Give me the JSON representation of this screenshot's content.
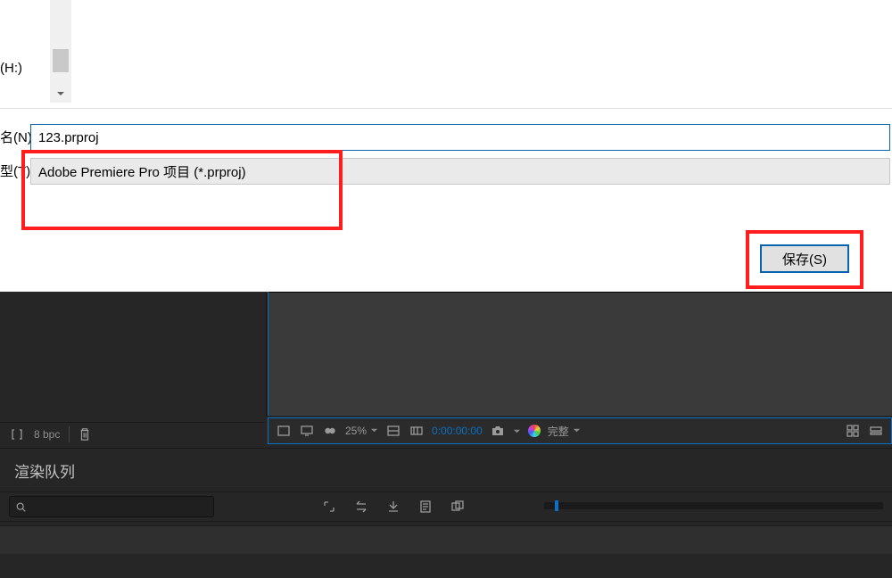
{
  "dialog": {
    "drive_label": "(H:)",
    "filename_label": "名(N):",
    "filetype_label": "型(T):",
    "filename_value": "123.prproj",
    "filetype_value": "Adobe Premiere Pro 项目 (*.prproj)",
    "save_button": "保存(S)"
  },
  "project": {
    "bpc_label": "8 bpc"
  },
  "viewer": {
    "zoom": "25%",
    "timecode": "0:00:00:00",
    "quality": "完整"
  },
  "render": {
    "title": "渲染队列"
  }
}
